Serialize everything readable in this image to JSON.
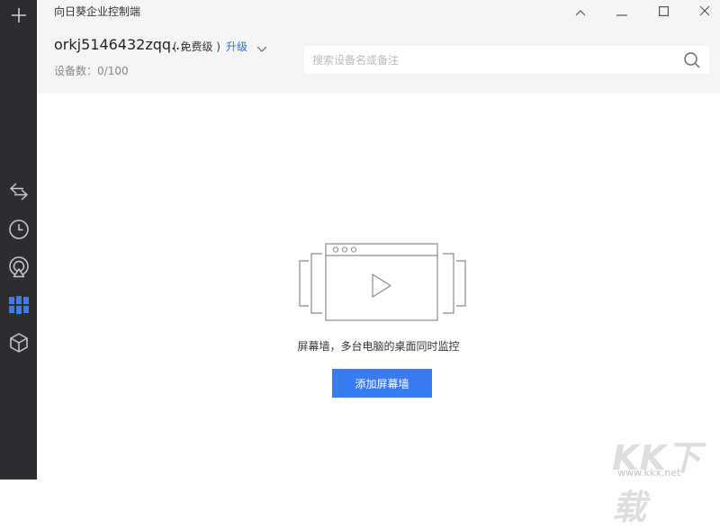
{
  "window": {
    "title": "向日葵企业控制端",
    "controls": [
      "minimize",
      "maximize",
      "close"
    ]
  },
  "sidebar": {
    "items": [
      {
        "name": "add",
        "icon": "plus-icon"
      },
      {
        "name": "remote-control",
        "icon": "arrows-swap-icon"
      },
      {
        "name": "history",
        "icon": "clock-icon"
      },
      {
        "name": "remote-observe",
        "icon": "broadcast-icon"
      },
      {
        "name": "screen-wall",
        "icon": "grid-icon",
        "active": true,
        "color": "#3a7bf0"
      },
      {
        "name": "device-box",
        "icon": "cube-icon"
      }
    ]
  },
  "account": {
    "name": "orkj5146432zqq...",
    "plan": "( 免费级 )",
    "upgrade_label": "升级",
    "device_count": "设备数：0/100"
  },
  "search": {
    "placeholder": "搜索设备名或备注",
    "value": ""
  },
  "empty_state": {
    "description": "屏幕墙，多台电脑的桌面同时监控",
    "button_label": "添加屏幕墙"
  },
  "watermark": {
    "logo": "KK下载",
    "url": "www.kkx.net"
  },
  "colors": {
    "sidebar_bg": "#2b2d31",
    "header_bg": "#f5f5f5",
    "accent": "#3a7bf0",
    "link": "#2f6fe4"
  }
}
